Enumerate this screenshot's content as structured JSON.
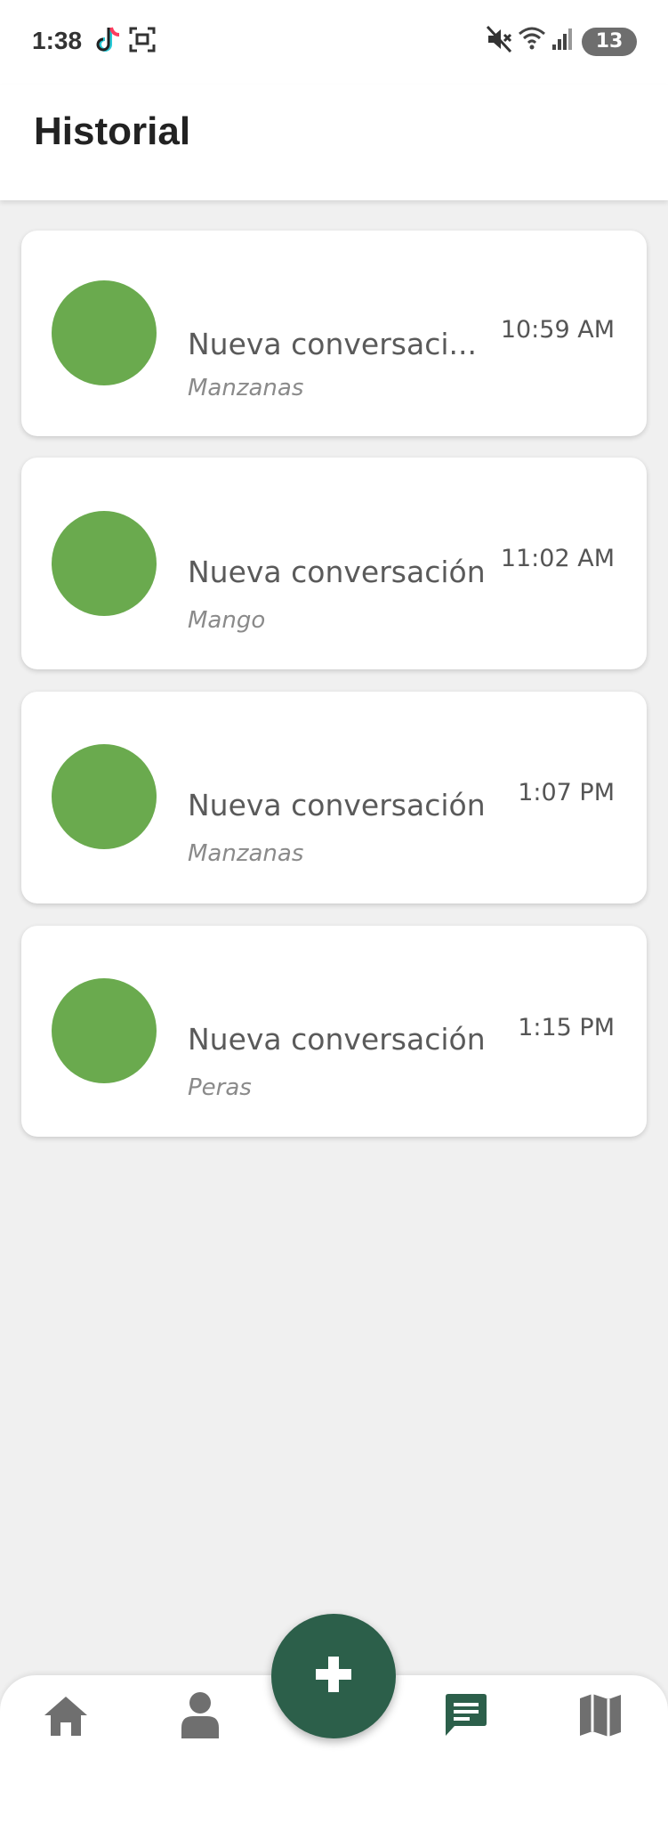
{
  "status_bar": {
    "time": "1:38",
    "battery_level": "13",
    "icons": [
      "tiktok-icon",
      "screenshot-icon",
      "mute-icon",
      "wifi-icon",
      "signal-icon",
      "battery-charging-icon"
    ]
  },
  "header": {
    "title": "Historial"
  },
  "conversations": [
    {
      "title": "Nueva conversaci...",
      "subtitle": "Manzanas",
      "time": "10:59 AM"
    },
    {
      "title": "Nueva conversación",
      "subtitle": "Mango",
      "time": "11:02 AM"
    },
    {
      "title": "Nueva conversación",
      "subtitle": "Manzanas",
      "time": "1:07 PM"
    },
    {
      "title": "Nueva conversación",
      "subtitle": "Peras",
      "time": "1:15 PM"
    }
  ],
  "bottom_nav": {
    "items": [
      "home-icon",
      "person-icon",
      "chat-icon",
      "map-icon"
    ],
    "active": "chat-icon",
    "fab_icon": "plus-icon"
  },
  "colors": {
    "avatar": "#6aaa4e",
    "primary": "#2c5f4a",
    "background": "#f0f0f0",
    "inactive_icon": "#6f6f6f"
  }
}
